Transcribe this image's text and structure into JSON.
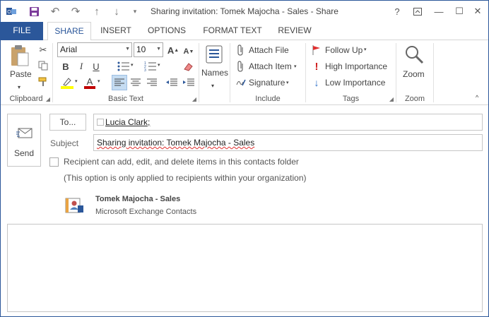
{
  "window": {
    "title": "Sharing invitation: Tomek Majocha - Sales - Share",
    "controls": {
      "help": "?",
      "restore_ribbon": "⊡",
      "minimize": "—",
      "maximize": "☐",
      "close": "✕"
    }
  },
  "qat": {
    "icons": [
      "outlook-icon",
      "save-icon",
      "undo-icon",
      "redo-icon",
      "up-icon",
      "down-icon",
      "customize-icon"
    ]
  },
  "tabs": [
    "FILE",
    "SHARE",
    "INSERT",
    "OPTIONS",
    "FORMAT TEXT",
    "REVIEW"
  ],
  "active_tab": "SHARE",
  "ribbon": {
    "clipboard": {
      "label": "Clipboard",
      "paste": "Paste"
    },
    "basic_text": {
      "label": "Basic Text",
      "font": "Arial",
      "size": "10"
    },
    "names": {
      "label": "Names"
    },
    "include": {
      "label": "Include",
      "attach_file": "Attach File",
      "attach_item": "Attach Item",
      "signature": "Signature"
    },
    "tags": {
      "label": "Tags",
      "follow_up": "Follow Up",
      "high_importance": "High Importance",
      "low_importance": "Low Importance"
    },
    "zoom": {
      "label": "Zoom",
      "zoom": "Zoom"
    }
  },
  "compose": {
    "send": "Send",
    "to_button": "To...",
    "to_value": "Lucia Clark;",
    "subject_label": "Subject",
    "subject_value": "Sharing invitation: Tomek Majocha - Sales",
    "permission_label": "Recipient can add, edit, and delete items in this contacts folder",
    "permission_checked": false,
    "note": "(This option is only applied to recipients within your organization)",
    "shared_folder": {
      "name": "Tomek Majocha - Sales",
      "type": "Microsoft Exchange Contacts"
    },
    "body": ""
  },
  "colors": {
    "accent": "#2b579a",
    "highlight": "#ffff00",
    "font_color": "#c00000",
    "flag": "#e03030",
    "high_importance": "#d02020",
    "low_importance": "#2b6fc9"
  }
}
